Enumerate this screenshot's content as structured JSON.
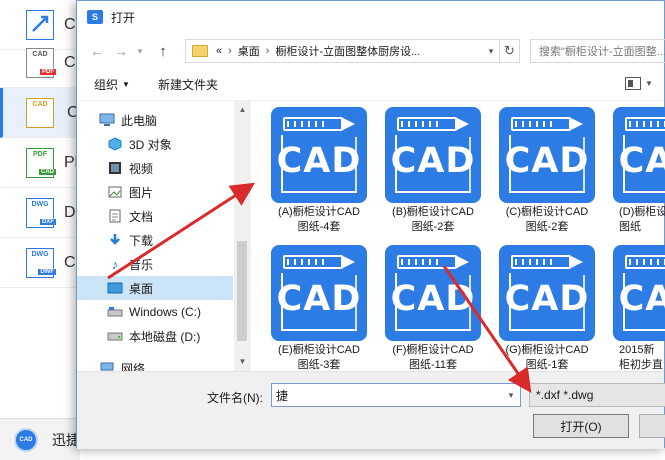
{
  "background_app": {
    "items": [
      {
        "icon_text": "",
        "tag": "",
        "letter": "C"
      },
      {
        "icon_text": "CAD",
        "tag": "PDF",
        "letter": "C"
      },
      {
        "icon_text": "CAD",
        "tag": "",
        "letter": "C"
      },
      {
        "icon_text": "PDF",
        "tag": "CAD",
        "letter": "Pl"
      },
      {
        "icon_text": "DWG",
        "tag": "DXF",
        "letter": "D"
      },
      {
        "icon_text": "DWG",
        "tag": "DWF",
        "letter": "C"
      }
    ],
    "bottom_icon_text": "CAD",
    "bottom_label": "迅捷"
  },
  "dialog": {
    "title": "打开",
    "address": {
      "prefix": "«",
      "segments": [
        "桌面",
        "橱柜设计-立面图整体厨房设..."
      ]
    },
    "search_placeholder": "搜索\"橱柜设计-立面图整...\"",
    "toolbar": {
      "organize": "组织",
      "new_folder": "新建文件夹"
    },
    "nav_tree": [
      {
        "label": "此电脑",
        "icon": "computer-icon",
        "selected": false
      },
      {
        "label": "3D 对象",
        "icon": "3d-objects-icon",
        "selected": false
      },
      {
        "label": "视频",
        "icon": "video-icon",
        "selected": false
      },
      {
        "label": "图片",
        "icon": "pictures-icon",
        "selected": false
      },
      {
        "label": "文档",
        "icon": "documents-icon",
        "selected": false
      },
      {
        "label": "下载",
        "icon": "download-icon",
        "selected": false
      },
      {
        "label": "音乐",
        "icon": "music-icon",
        "selected": false
      },
      {
        "label": "桌面",
        "icon": "desktop-icon",
        "selected": true
      },
      {
        "label": "Windows (C:)",
        "icon": "drive-icon",
        "selected": false
      },
      {
        "label": "本地磁盘 (D:)",
        "icon": "drive-icon",
        "selected": false
      },
      {
        "label": "网络",
        "icon": "network-icon",
        "selected": false
      }
    ],
    "files": [
      {
        "icon_text": "CAD",
        "label_line1": "(A)橱柜设计CAD",
        "label_line2": "图纸-4套"
      },
      {
        "icon_text": "CAD",
        "label_line1": "(B)橱柜设计CAD",
        "label_line2": "图纸-2套"
      },
      {
        "icon_text": "CAD",
        "label_line1": "(C)橱柜设计CAD",
        "label_line2": "图纸-2套"
      },
      {
        "icon_text": "CAD",
        "label_line1": "(D)橱柜设",
        "label_line2": "图纸"
      },
      {
        "icon_text": "CAD",
        "label_line1": "(E)橱柜设计CAD",
        "label_line2": "图纸-3套"
      },
      {
        "icon_text": "CAD",
        "label_line1": "(F)橱柜设计CAD",
        "label_line2": "图纸-11套"
      },
      {
        "icon_text": "CAD",
        "label_line1": "(G)橱柜设计CAD",
        "label_line2": "图纸-1套"
      },
      {
        "icon_text": "CAD",
        "label_line1": "2015新",
        "label_line2": "柜初步直"
      }
    ],
    "filename_label": "文件名(N):",
    "filename_value": "捷",
    "filetype_value": "*.dxf *.dwg",
    "open_button": "打开(O)"
  },
  "colors": {
    "accent": "#2d7be5",
    "arrow": "#d92b2b",
    "selection": "#cce4f7"
  }
}
